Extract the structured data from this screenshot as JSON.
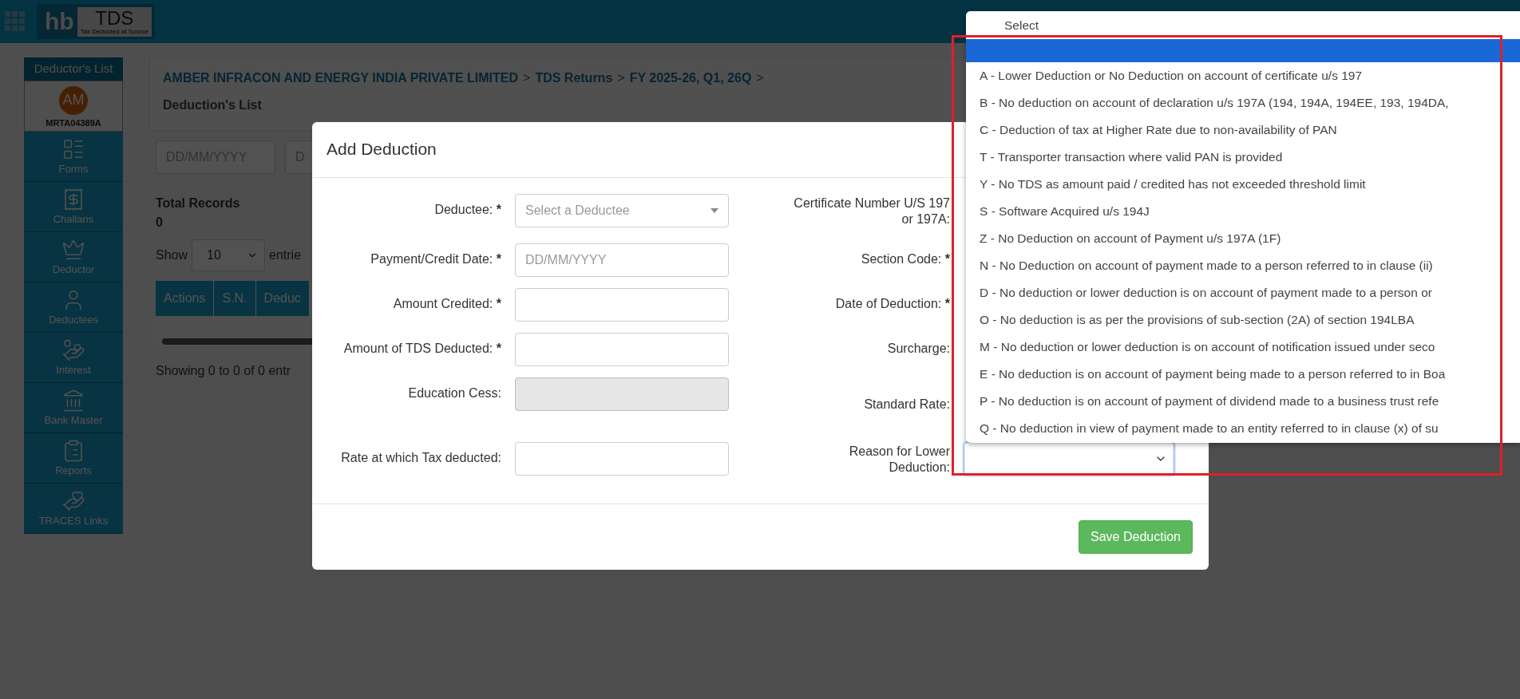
{
  "header": {
    "logo_left": "hb",
    "logo_right": "TDS",
    "logo_tagline": "Tax Deducted at Source"
  },
  "sidebar": {
    "title": "Deductor's List",
    "avatar": "AM",
    "code": "MRTA04389A",
    "items": [
      {
        "label": "Forms",
        "kind": "forms"
      },
      {
        "label": "Challans",
        "kind": "challans"
      },
      {
        "label": "Deductor",
        "kind": "deductor"
      },
      {
        "label": "Deductees",
        "kind": "deductees"
      },
      {
        "label": "Interest",
        "kind": "interest"
      },
      {
        "label": "Bank Master",
        "kind": "bank"
      },
      {
        "label": "Reports",
        "kind": "reports"
      },
      {
        "label": "TRACES Links",
        "kind": "traces"
      }
    ]
  },
  "page": {
    "breadcrumb": [
      {
        "label": "AMBER INFRACON AND ENERGY INDIA PRIVATE LIMITED",
        "separator": ">"
      },
      {
        "label": "TDS Returns",
        "separator": ">"
      },
      {
        "label": "FY 2025-26, Q1, 26Q",
        "separator": ">"
      }
    ],
    "subtitle": "Deduction's List",
    "filters": [
      {
        "placeholder": "DD/MM/YYYY"
      },
      {
        "placeholder": "D"
      }
    ],
    "total_label": "Total Records",
    "total_value": "0",
    "show_label": "Show",
    "page_size": "10",
    "entries_label": "entrie",
    "table_columns": [
      "Actions",
      "S.N.",
      "Deduc"
    ],
    "footer_text": "Showing 0 to 0 of 0 entr"
  },
  "modal": {
    "title": "Add Deduction",
    "left_fields": [
      {
        "label": "Deductee:",
        "required_mark": "*",
        "kind": "select",
        "placeholder": "Select a Deductee"
      },
      {
        "label": "Payment/Credit Date:",
        "required_mark": "*",
        "kind": "text",
        "placeholder": "DD/MM/YYYY",
        "disabled": false
      },
      {
        "label": "Amount Credited:",
        "required_mark": "*",
        "kind": "text",
        "disabled": false
      },
      {
        "label": "Amount of TDS Deducted:",
        "required_mark": "*",
        "kind": "text",
        "disabled": false
      },
      {
        "label": "Education Cess:",
        "kind": "text",
        "disabled": true
      },
      {
        "label": "Rate at which Tax deducted:",
        "kind": "text",
        "disabled": false
      }
    ],
    "right_fields": [
      {
        "label": "Certificate Number U/S 197 or 197A:"
      },
      {
        "label": "Section Code:",
        "required_mark": "*"
      },
      {
        "label": "Date of Deduction:",
        "required_mark": "*"
      },
      {
        "label": "Surcharge:"
      },
      {
        "label": "Standard Rate:"
      },
      {
        "label": "Reason for Lower Deduction:",
        "kind": "select"
      }
    ],
    "save_button": "Save Deduction"
  },
  "dropdown": {
    "options": [
      {
        "label": "Select",
        "selected": false
      },
      {
        "selected": true
      },
      {
        "label": "A - Lower Deduction or No Deduction on account of certificate u/s 197",
        "selected": false
      },
      {
        "label": "B - No deduction on account of declaration u/s 197A (194, 194A, 194EE, 193, 194DA,",
        "selected": false
      },
      {
        "label": "C - Deduction of tax at Higher Rate due to non-availability of PAN",
        "selected": false
      },
      {
        "label": "T - Transporter transaction where valid PAN is provided",
        "selected": false
      },
      {
        "label": "Y - No TDS as amount paid / credited has not exceeded threshold limit",
        "selected": false
      },
      {
        "label": "S - Software Acquired u/s 194J",
        "selected": false
      },
      {
        "label": "Z - No Deduction on account of Payment u/s 197A (1F)",
        "selected": false
      },
      {
        "label": "N - No Deduction on account of payment made to a person referred to in clause (ii)",
        "selected": false
      },
      {
        "label": "D - No deduction or lower deduction is on account of payment made to a person or",
        "selected": false
      },
      {
        "label": "O - No deduction is as per the provisions of sub-section (2A) of section 194LBA",
        "selected": false
      },
      {
        "label": "M - No deduction or lower deduction is on account of notification issued under seco",
        "selected": false
      },
      {
        "label": "E - No deduction is on account of payment being made to a person referred to in Boa",
        "selected": false
      },
      {
        "label": "P - No deduction is on account of payment of dividend made to a business trust refe",
        "selected": false
      },
      {
        "label": "Q - No deduction in view of payment made to an entity referred to in clause (x) of su",
        "selected": false
      }
    ]
  }
}
